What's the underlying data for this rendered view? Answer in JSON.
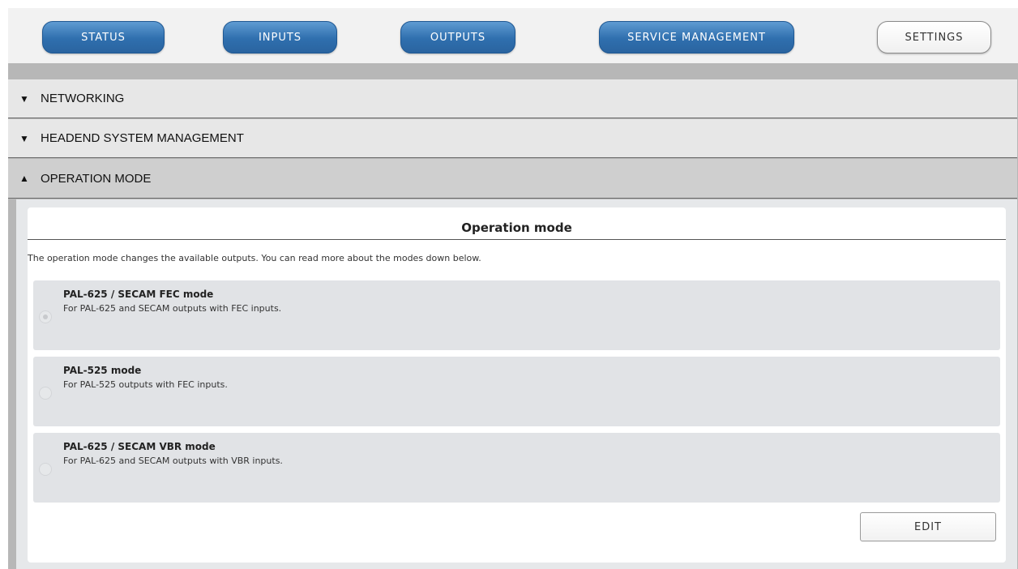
{
  "nav": {
    "status": "STATUS",
    "inputs": "INPUTS",
    "outputs": "OUTPUTS",
    "service_management": "SERVICE MANAGEMENT",
    "settings": "SETTINGS",
    "active": "SETTINGS"
  },
  "accordion": {
    "networking": "NETWORKING",
    "headend": "HEADEND SYSTEM MANAGEMENT",
    "operation_mode": "OPERATION MODE",
    "collapsed_arrow": "▼",
    "expanded_arrow": "▲"
  },
  "operation": {
    "title": "Operation mode",
    "description": "The operation mode changes the available outputs. You can read more about the modes down below.",
    "options": [
      {
        "title": "PAL-625 / SECAM FEC mode",
        "subtitle": "For PAL-625 and SECAM outputs with FEC inputs.",
        "selected": true
      },
      {
        "title": "PAL-525 mode",
        "subtitle": "For PAL-525 outputs with FEC inputs.",
        "selected": false
      },
      {
        "title": "PAL-625 / SECAM VBR mode",
        "subtitle": "For PAL-625 and SECAM outputs with VBR inputs.",
        "selected": false
      }
    ],
    "edit_label": "EDIT"
  },
  "colors": {
    "nav_blue": "#2f6fae",
    "frame_gray": "#b7b7b7",
    "accordion_bg": "#e7e7e7",
    "option_bg": "#e1e3e6"
  }
}
